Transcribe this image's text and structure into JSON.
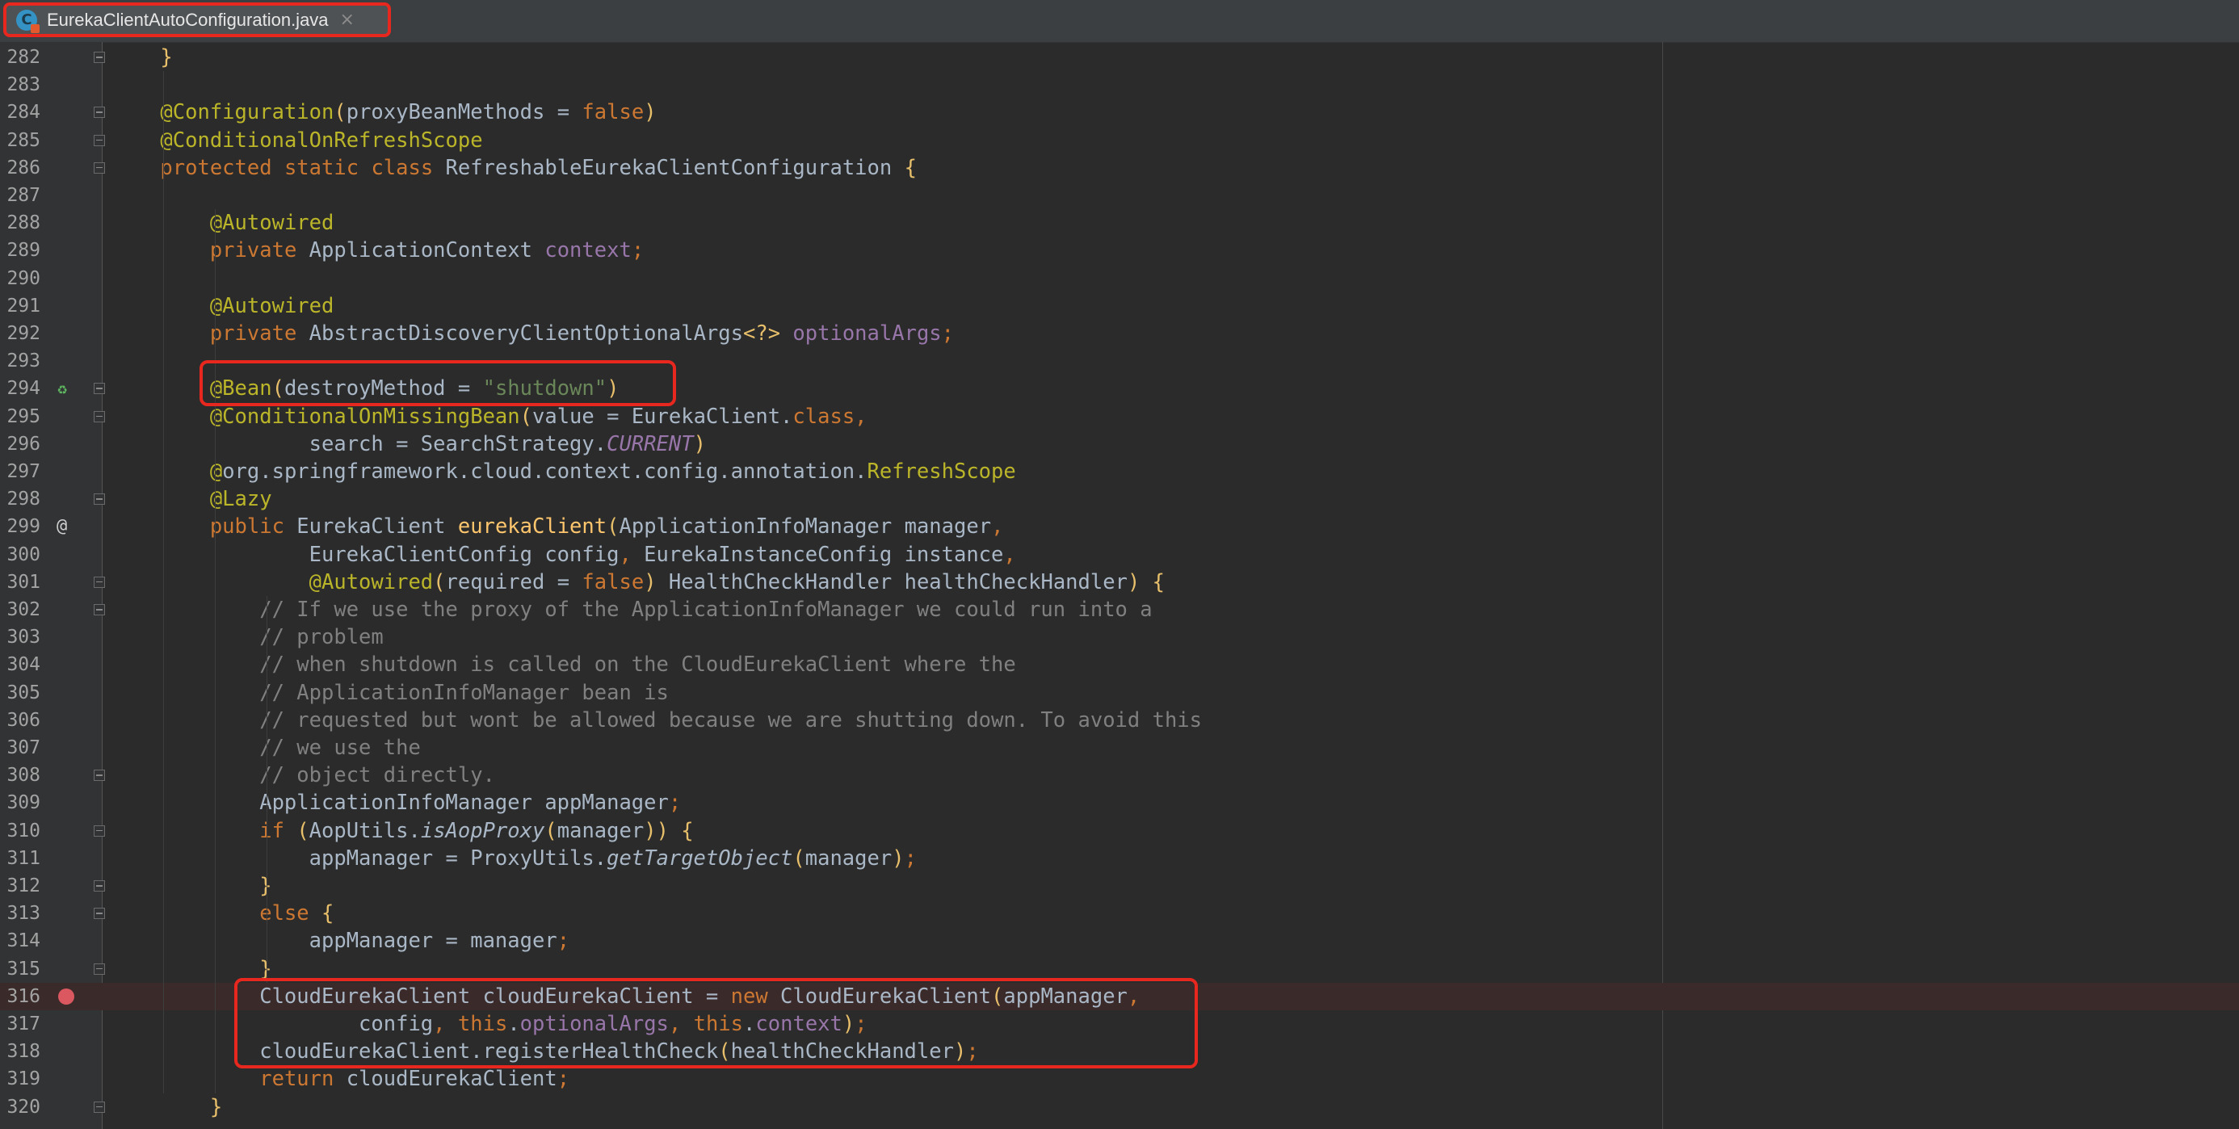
{
  "tab": {
    "title": "EurekaClientAutoConfiguration.java",
    "icon": "java-class-icon",
    "close_glyph": "×"
  },
  "lines": [
    {
      "num": "282",
      "text": "    }"
    },
    {
      "num": "283",
      "text": ""
    },
    {
      "num": "284",
      "text": "    @Configuration(proxyBeanMethods = false)"
    },
    {
      "num": "285",
      "text": "    @ConditionalOnRefreshScope"
    },
    {
      "num": "286",
      "text": "    protected static class RefreshableEurekaClientConfiguration {"
    },
    {
      "num": "287",
      "text": ""
    },
    {
      "num": "288",
      "text": "        @Autowired"
    },
    {
      "num": "289",
      "text": "        private ApplicationContext context;"
    },
    {
      "num": "290",
      "text": ""
    },
    {
      "num": "291",
      "text": "        @Autowired"
    },
    {
      "num": "292",
      "text": "        private AbstractDiscoveryClientOptionalArgs<?> optionalArgs;"
    },
    {
      "num": "293",
      "text": ""
    },
    {
      "num": "294",
      "text": "        @Bean(destroyMethod = \"shutdown\")"
    },
    {
      "num": "295",
      "text": "        @ConditionalOnMissingBean(value = EurekaClient.class,"
    },
    {
      "num": "296",
      "text": "                search = SearchStrategy.CURRENT)"
    },
    {
      "num": "297",
      "text": "        @org.springframework.cloud.context.config.annotation.RefreshScope"
    },
    {
      "num": "298",
      "text": "        @Lazy"
    },
    {
      "num": "299",
      "text": "        public EurekaClient eurekaClient(ApplicationInfoManager manager,"
    },
    {
      "num": "300",
      "text": "                EurekaClientConfig config, EurekaInstanceConfig instance,"
    },
    {
      "num": "301",
      "text": "                @Autowired(required = false) HealthCheckHandler healthCheckHandler) {"
    },
    {
      "num": "302",
      "text": "            // If we use the proxy of the ApplicationInfoManager we could run into a"
    },
    {
      "num": "303",
      "text": "            // problem"
    },
    {
      "num": "304",
      "text": "            // when shutdown is called on the CloudEurekaClient where the"
    },
    {
      "num": "305",
      "text": "            // ApplicationInfoManager bean is"
    },
    {
      "num": "306",
      "text": "            // requested but wont be allowed because we are shutting down. To avoid this"
    },
    {
      "num": "307",
      "text": "            // we use the"
    },
    {
      "num": "308",
      "text": "            // object directly."
    },
    {
      "num": "309",
      "text": "            ApplicationInfoManager appManager;"
    },
    {
      "num": "310",
      "text": "            if (AopUtils.isAopProxy(manager)) {"
    },
    {
      "num": "311",
      "text": "                appManager = ProxyUtils.getTargetObject(manager);"
    },
    {
      "num": "312",
      "text": "            }"
    },
    {
      "num": "313",
      "text": "            else {"
    },
    {
      "num": "314",
      "text": "                appManager = manager;"
    },
    {
      "num": "315",
      "text": "            }"
    },
    {
      "num": "316",
      "text": "            CloudEurekaClient cloudEurekaClient = new CloudEurekaClient(appManager,"
    },
    {
      "num": "317",
      "text": "                    config, this.optionalArgs, this.context);"
    },
    {
      "num": "318",
      "text": "            cloudEurekaClient.registerHealthCheck(healthCheckHandler);"
    },
    {
      "num": "319",
      "text": "            return cloudEurekaClient;"
    },
    {
      "num": "320",
      "text": "        }"
    }
  ],
  "gutter_markers": {
    "bean_line": "294",
    "override_line": "299",
    "override_glyph": "@",
    "breakpoint_line": "316"
  },
  "colors": {
    "background": "#2b2b2b",
    "keyword": "#cc7832",
    "annotation": "#bbb529",
    "string": "#6a8759",
    "field": "#9876aa",
    "method": "#ffc66d",
    "comment": "#808080",
    "highlight_box": "#e8271f"
  }
}
